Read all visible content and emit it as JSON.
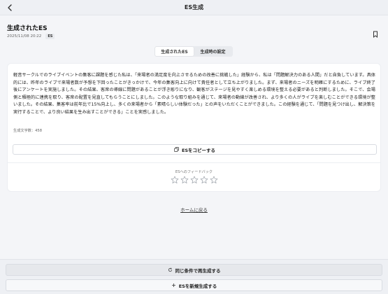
{
  "topbar": {
    "title": "ES生成"
  },
  "header": {
    "title": "生成されたES",
    "date": "2025/11/08 20:22",
    "badge": "ES"
  },
  "tabs": [
    {
      "label": "生成されたES",
      "active": true
    },
    {
      "label": "生成時の設定",
      "active": false
    }
  ],
  "es": {
    "text": "軽音サークルでのライブイベントの集客に課題を感じた私は、「来場者の満足度を向上させるための改善に挑戦した」経験から、私は「問題解決力のある人間」だと自負しています。具体的には、昨年のライブで来場者数が予想を下回ったことがきっかけで、今年の集客向上に向けて責任者として立ち上がりました。まず、来場者のニーズを明確にするために、ライブ終了後にアンケートを実施しました。その結果、客席の導線に問題があることが浮き彫りになり、観客がステージを見やすく楽しめる環境を整える必要があると判断しました。そこで、会場側と積極的に連携を取り、客席の配置を見直してもらうことにしました。このような取り組みを通じて、来場者の動線が改善され、より多くの人がライブを楽しむことができる環境が整いました。その結果、集客率は前年比で15%向上し、多くの来場者から「素晴らしい体験だった」との声をいただくことができました。この経験を通じて、「問題を見つけ出し、解決策を実行することで、より良い結果を生み出すことができる」ことを実感しました。",
    "char_count": "生成文字数：458"
  },
  "actions": {
    "copy_label": "ESをコピーする",
    "feedback_label": "ESへのフィードバック",
    "rating": 0,
    "max_rating": 5,
    "home_label": "ホームに戻る",
    "regen_label": "同じ条件で再生成する",
    "new_label": "ESを新規生成する"
  },
  "icons": {
    "back": "chevron-left-icon",
    "bookmark": "bookmark-icon",
    "copy": "copy-icon",
    "star": "star-outline-icon",
    "regen": "refresh-icon",
    "new": "plus-icon"
  }
}
